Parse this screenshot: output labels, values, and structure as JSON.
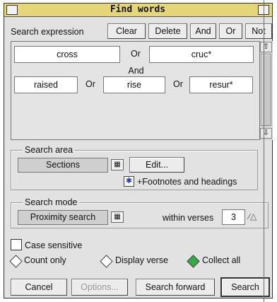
{
  "window": {
    "title": "Find words"
  },
  "header": {
    "label": "Search expression",
    "buttons": {
      "clear": "Clear",
      "delete": "Delete",
      "and": "And",
      "or": "Or",
      "not": "Not"
    }
  },
  "expression": {
    "row1": {
      "term1": "cross",
      "op": "Or",
      "term2": "cruc*"
    },
    "join": "And",
    "row2": {
      "term1": "raised",
      "op1": "Or",
      "term2": "rise",
      "op2": "Or",
      "term3": "resur*"
    }
  },
  "search_area": {
    "label": "Search area",
    "value": "Sections",
    "edit_label": "Edit...",
    "footnotes_label": "+Footnotes and headings"
  },
  "search_mode": {
    "label": "Search mode",
    "value": "Proximity search",
    "within_label": "within verses",
    "within_value": "3"
  },
  "options": {
    "case_sensitive": "Case sensitive",
    "count_only": "Count only",
    "display_verse": "Display verse",
    "collect_all": "Collect all"
  },
  "footer": {
    "cancel": "Cancel",
    "options": "Options...",
    "search_forward": "Search forward",
    "search": "Search"
  }
}
